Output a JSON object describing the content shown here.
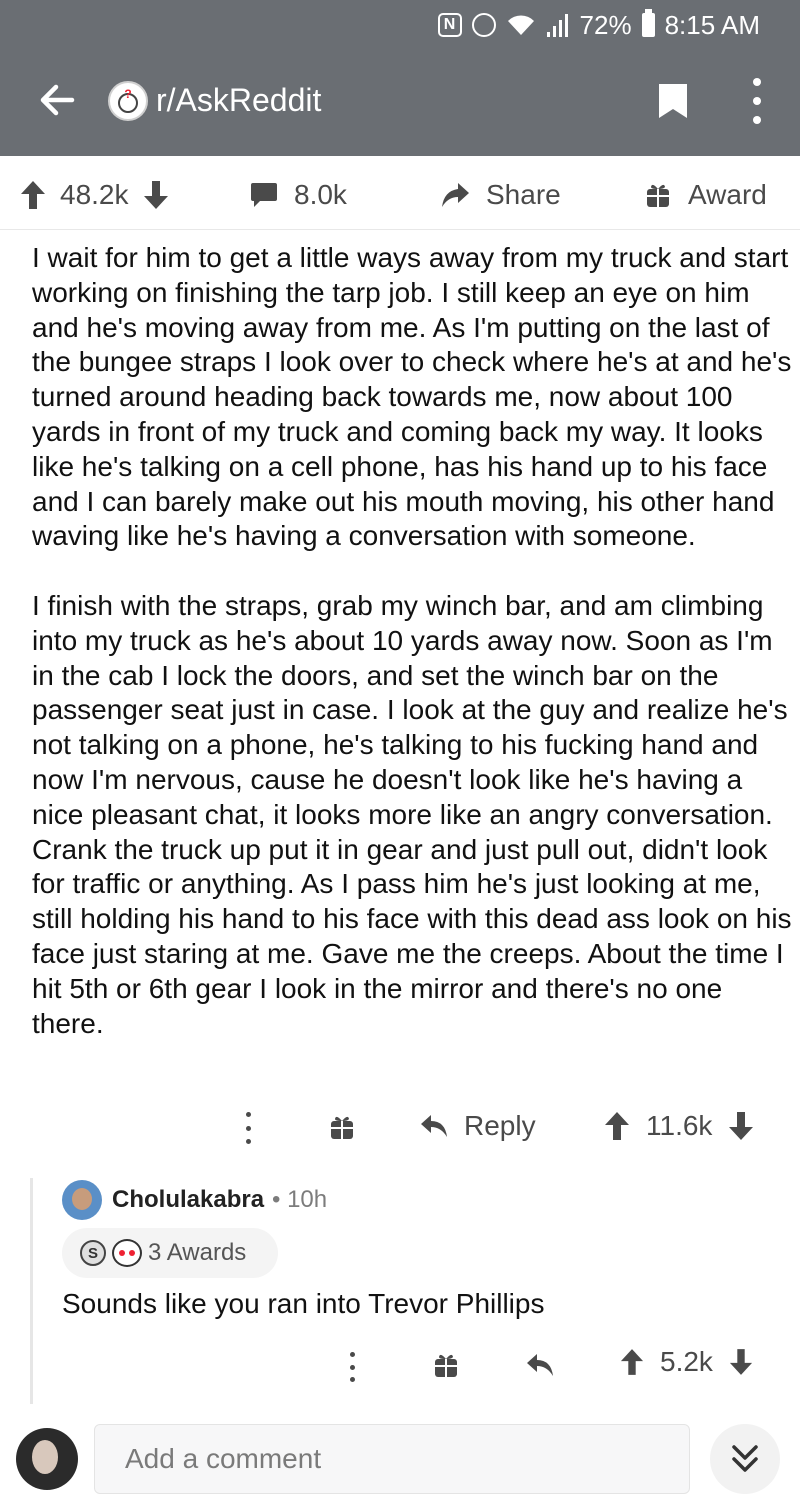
{
  "status_bar": {
    "nfc_icon": "nfc-icon",
    "alarm_icon": "alarm-icon",
    "battery": "72%",
    "time": "8:15 AM"
  },
  "app_bar": {
    "subreddit": "r/AskReddit"
  },
  "post_actions": {
    "score": "48.2k",
    "comments": "8.0k",
    "share": "Share",
    "award": "Award"
  },
  "comment": {
    "paragraphs": [
      "I wait for him to get a little ways away from my truck and start working on finishing the tarp job.  I still keep an eye on him and he's moving away from me.  As I'm putting on the last of the bungee straps I look over to check where he's at and he's turned around heading back towards me, now about 100 yards in front of my truck and coming back my way.  It looks like he's talking on a cell phone, has his hand up to his face and I can barely make out his mouth moving, his other hand waving like he's having a conversation with someone.",
      "I finish with the straps, grab my winch bar, and am climbing into my truck as he's about 10 yards away now. Soon as I'm in the cab I lock the doors, and set the winch bar on the passenger seat just in case.  I look at the guy and realize he's not talking on a phone, he's talking to his fucking hand and now I'm nervous, cause he doesn't look like he's having a nice pleasant chat, it looks more like an angry conversation.  Crank the truck up put it in gear and just pull out, didn't look for traffic or anything.  As I pass him he's just looking at me, still holding his hand to his face with this dead ass look on his face just staring at me.  Gave me the creeps.  About the time I hit 5th or 6th gear I look in the mirror and there's no one there."
    ],
    "reply_label": "Reply",
    "score": "11.6k"
  },
  "reply": {
    "username": "Cholulakabra",
    "age": "10h",
    "awards": "3 Awards",
    "text": "Sounds like you ran into Trevor Phillips",
    "score": "5.2k"
  },
  "composer": {
    "placeholder": "Add a comment"
  },
  "colors": {
    "app_bar": "#6a6e73",
    "text": "#111111",
    "icon": "#4a4a4a"
  }
}
